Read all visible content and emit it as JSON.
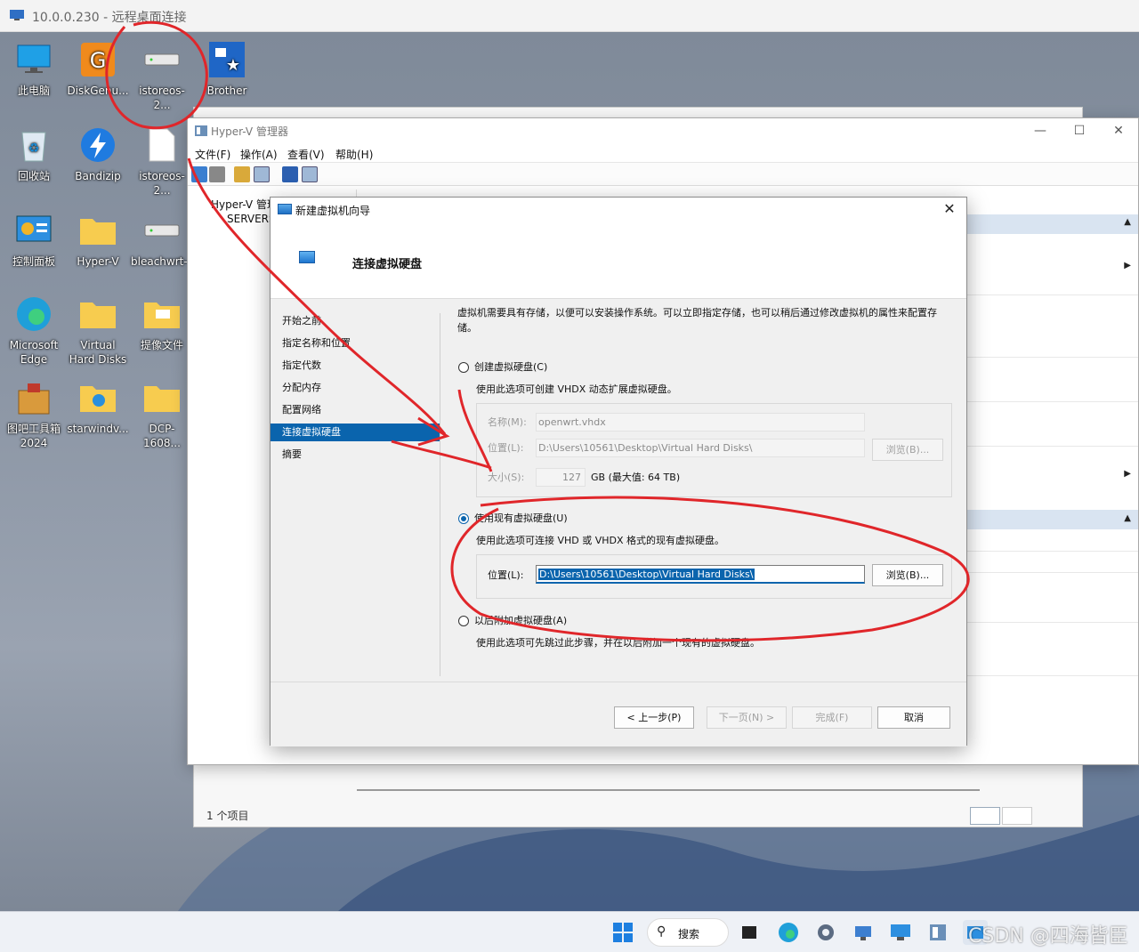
{
  "rdp": {
    "title": "10.0.0.230 - 远程桌面连接"
  },
  "desktop": {
    "icons": [
      {
        "label": "此电脑"
      },
      {
        "label": "DiskGenu..."
      },
      {
        "label": "istoreos-2..."
      },
      {
        "label": "Brother"
      },
      {
        "label": "回收站"
      },
      {
        "label": "Bandizip"
      },
      {
        "label": "istoreos-2..."
      },
      {
        "label": "控制面板"
      },
      {
        "label": "Hyper-V"
      },
      {
        "label": "bleachwrt-..."
      },
      {
        "label": "Microsoft Edge"
      },
      {
        "label": "Virtual Hard Disks"
      },
      {
        "label": "提像文件"
      },
      {
        "label": "图吧工具箱 2024"
      },
      {
        "label": "starwindv..."
      },
      {
        "label": "DCP-1608..."
      }
    ]
  },
  "background_window": {
    "status": "1 个项目"
  },
  "hyperv": {
    "title": "Hyper-V 管理器",
    "menu": [
      "文件(F)",
      "操作(A)",
      "查看(V)",
      "帮助(H)"
    ],
    "tree": {
      "root": "Hyper-V 管理",
      "server": "SERVERS"
    }
  },
  "wizard": {
    "title": "新建虚拟机向导",
    "heading": "连接虚拟硬盘",
    "steps": [
      "开始之前",
      "指定名称和位置",
      "指定代数",
      "分配内存",
      "配置网络",
      "连接虚拟硬盘",
      "摘要"
    ],
    "active_step": "连接虚拟硬盘",
    "intro": "虚拟机需要具有存储，以便可以安装操作系统。可以立即指定存储，也可以稍后通过修改虚拟机的属性来配置存储。",
    "option_create": {
      "label": "创建虚拟硬盘(C)",
      "desc": "使用此选项可创建 VHDX 动态扩展虚拟硬盘。",
      "name_label": "名称(M):",
      "name_value": "openwrt.vhdx",
      "location_label": "位置(L):",
      "location_value": "D:\\Users\\10561\\Desktop\\Virtual Hard Disks\\",
      "browse": "浏览(B)...",
      "size_label": "大小(S):",
      "size_value": "127",
      "size_unit": "GB (最大值: 64 TB)",
      "selected": false
    },
    "option_existing": {
      "label": "使用现有虚拟硬盘(U)",
      "desc": "使用此选项可连接 VHD 或 VHDX 格式的现有虚拟硬盘。",
      "location_label": "位置(L):",
      "location_value": "D:\\Users\\10561\\Desktop\\Virtual Hard Disks\\",
      "browse": "浏览(B)...",
      "selected": true
    },
    "option_later": {
      "label": "以后附加虚拟硬盘(A)",
      "desc": "使用此选项可先跳过此步骤，并在以后附加一个现有的虚拟硬盘。",
      "selected": false
    },
    "buttons": {
      "prev": "< 上一步(P)",
      "next": "下一页(N) >",
      "finish": "完成(F)",
      "cancel": "取消"
    }
  },
  "taskbar": {
    "search": "搜索"
  },
  "watermark": "CSDN @四海皆臣",
  "colors": {
    "accent": "#0a64ad",
    "annotation": "#e0262a"
  }
}
